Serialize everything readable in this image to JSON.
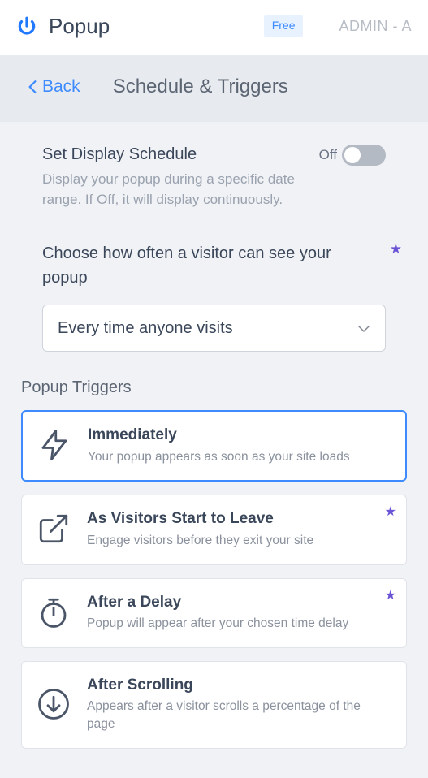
{
  "appbar": {
    "brand": "Popup",
    "badge": "Free",
    "admin": "ADMIN - A"
  },
  "header": {
    "back": "Back",
    "title": "Schedule & Triggers"
  },
  "schedule": {
    "title": "Set Display Schedule",
    "desc": "Display your popup during a specific date range. If Off, it will display continuously.",
    "state_label": "Off"
  },
  "frequency": {
    "title": "Choose how often a visitor can see your popup",
    "selected": "Every time anyone visits"
  },
  "triggers_label": "Popup Triggers",
  "triggers": [
    {
      "title": "Immediately",
      "desc": "Your popup appears as soon as your site loads"
    },
    {
      "title": "As Visitors Start to Leave",
      "desc": "Engage visitors before they exit your site"
    },
    {
      "title": "After a Delay",
      "desc": "Popup will appear after your chosen time delay"
    },
    {
      "title": "After Scrolling",
      "desc": "Appears after a visitor scrolls a percentage of the page"
    }
  ]
}
